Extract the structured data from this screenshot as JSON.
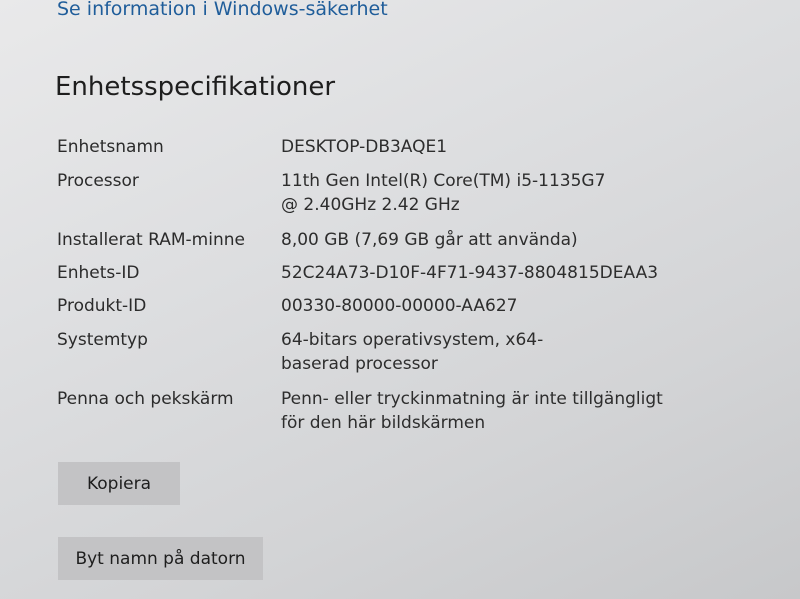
{
  "top_link": "Se information i Windows-säkerhet",
  "heading": "Enhetsspecifikationer",
  "specs": [
    {
      "label": "Enhetsnamn",
      "value": "DESKTOP-DB3AQE1"
    },
    {
      "label": "Processor",
      "value": "11th Gen Intel(R) Core(TM) i5-1135G7 @ 2.40GHz   2.42 GHz"
    },
    {
      "label": "Installerat RAM-minne",
      "value": "8,00 GB (7,69 GB går att använda)"
    },
    {
      "label": "Enhets-ID",
      "value": "52C24A73-D10F-4F71-9437-8804815DEAA3"
    },
    {
      "label": "Produkt-ID",
      "value": "00330-80000-00000-AA627"
    },
    {
      "label": "Systemtyp",
      "value": "64-bitars operativsystem, x64-baserad processor"
    },
    {
      "label": "Penna och pekskärm",
      "value": "Penn- eller tryckinmatning är inte tillgängligt för den här bildskärmen"
    }
  ],
  "buttons": {
    "copy": "Kopiera",
    "rename": "Byt namn på datorn"
  }
}
